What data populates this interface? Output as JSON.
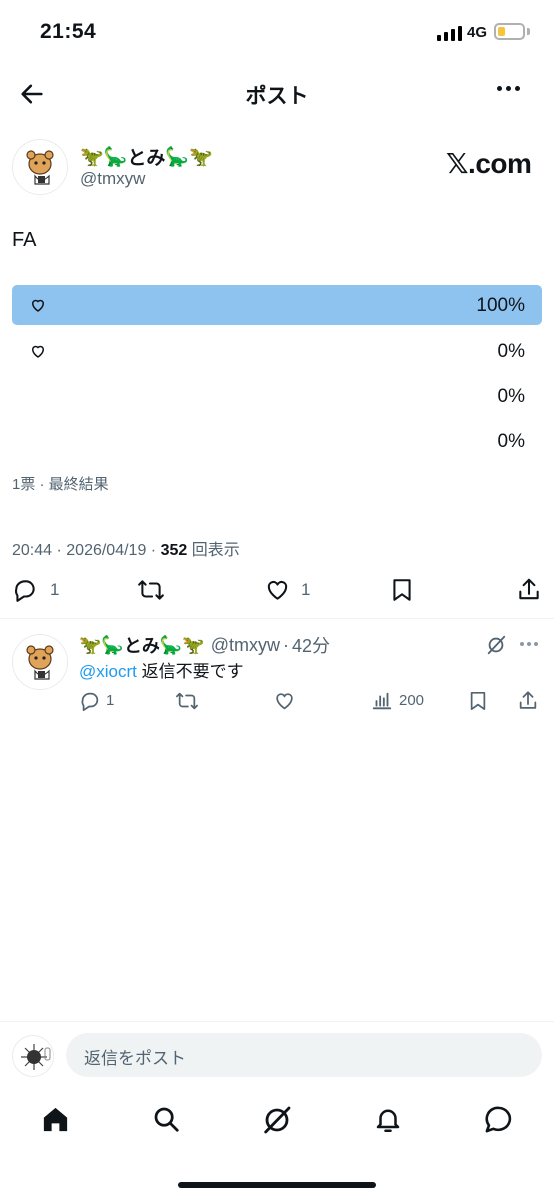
{
  "status_bar": {
    "time": "21:54",
    "network": "4G",
    "battery_level": 0.3
  },
  "header": {
    "title": "ポスト",
    "back_icon": "arrow-left-icon",
    "more_icon": "more-dots-icon"
  },
  "author": {
    "name": "とみ",
    "name_decorations": [
      "🦖",
      "🦕",
      "🦕",
      "🦖"
    ],
    "handle": "@tmxyw",
    "brand": "𝕏.com"
  },
  "post": {
    "text": "FA"
  },
  "poll": {
    "options": [
      {
        "label_icon": "heart-icon",
        "percent_text": "100%",
        "percent": 100,
        "winner": true
      },
      {
        "label_icon": "heart-icon",
        "percent_text": "0%",
        "percent": 0
      },
      {
        "label_icon": "",
        "percent_text": "0%",
        "percent": 0
      },
      {
        "label_icon": "",
        "percent_text": "0%",
        "percent": 0
      }
    ],
    "summary": "1票 · 最終結果"
  },
  "post_meta": {
    "time": "20:44",
    "date": "2026/04/19",
    "views": "352",
    "views_label": "回表示"
  },
  "actions": {
    "replies": "1",
    "reposts": "",
    "likes": "1"
  },
  "reply": {
    "name": "とみ",
    "handle": "@tmxyw",
    "age": "42分",
    "mention": "@xiocrt",
    "text": "返信不要です",
    "replies": "1",
    "views": "200"
  },
  "composer": {
    "placeholder": "返信をポスト"
  },
  "colors": {
    "accent": "#1d9bf0",
    "poll_winner": "#8ec3f0",
    "text": "#0f1419",
    "secondary": "#536471"
  }
}
